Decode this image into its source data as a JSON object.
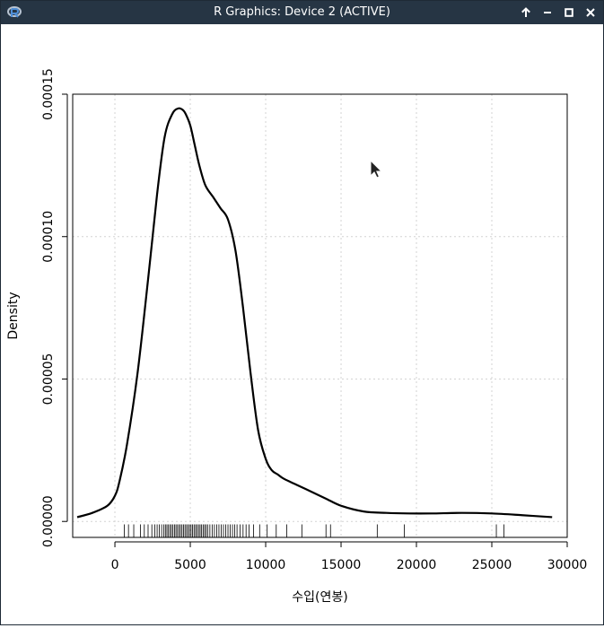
{
  "window": {
    "title": "R Graphics: Device 2 (ACTIVE)",
    "icon": "r-logo-icon",
    "controls": [
      "maximize-up-icon",
      "minimize-icon",
      "restore-icon",
      "close-icon"
    ]
  },
  "chart_data": {
    "type": "line",
    "title": "",
    "xlabel": "수입(연봉)",
    "ylabel": "Density",
    "xlim": [
      -2800,
      30000
    ],
    "ylim": [
      -5.6e-06,
      0.00015
    ],
    "x_ticks": [
      0,
      5000,
      10000,
      15000,
      20000,
      25000,
      30000
    ],
    "x_tick_labels": [
      "0",
      "5000",
      "10000",
      "15000",
      "20000",
      "25000",
      "30000"
    ],
    "y_ticks": [
      0,
      5e-05,
      0.0001,
      0.00015
    ],
    "y_tick_labels": [
      "0.00000",
      "0.00005",
      "0.00010",
      "0.00015"
    ],
    "grid": true,
    "series": [
      {
        "x": [
          -2500,
          -1500,
          -500,
          0,
          300,
          800,
          1500,
          2200,
          2800,
          3300,
          3800,
          4200,
          4500,
          4700,
          5000,
          5300,
          5600,
          6000,
          6500,
          7000,
          7500,
          8000,
          8500,
          9000,
          9500,
          10000,
          10400,
          10800,
          11200,
          12000,
          13000,
          14000,
          15000,
          16500,
          18000,
          19500,
          21000,
          23000,
          25000,
          27000,
          29000
        ],
        "y": [
          1.5e-06,
          3e-06,
          5.5e-06,
          9e-06,
          1.4e-05,
          2.7e-05,
          5.2e-05,
          8.5e-05,
          0.000115,
          0.000135,
          0.000143,
          0.000145,
          0.0001445,
          0.000143,
          0.000139,
          0.000132,
          0.000125,
          0.000118,
          0.000114,
          0.00011,
          0.000106,
          9.5e-05,
          7.5e-05,
          5.2e-05,
          3.2e-05,
          2.2e-05,
          1.8e-05,
          1.65e-05,
          1.5e-05,
          1.3e-05,
          1.05e-05,
          8e-06,
          5.5e-06,
          3.5e-06,
          3e-06,
          2.8e-06,
          2.8e-06,
          3e-06,
          2.8e-06,
          2.2e-06,
          1.5e-06
        ]
      }
    ],
    "rug": [
      620,
      900,
      1250,
      1700,
      1950,
      2200,
      2450,
      2650,
      2800,
      2950,
      3100,
      3250,
      3350,
      3450,
      3550,
      3650,
      3750,
      3850,
      3950,
      4050,
      4150,
      4250,
      4350,
      4450,
      4550,
      4650,
      4750,
      4850,
      4950,
      5050,
      5150,
      5250,
      5350,
      5450,
      5550,
      5650,
      5750,
      5850,
      5950,
      6050,
      6150,
      6300,
      6450,
      6600,
      6750,
      6900,
      7050,
      7200,
      7350,
      7500,
      7650,
      7800,
      7950,
      8100,
      8300,
      8500,
      8700,
      8900,
      9200,
      9600,
      10100,
      10700,
      11400,
      12400,
      14000,
      14300,
      17400,
      19200,
      25300,
      25800
    ]
  }
}
